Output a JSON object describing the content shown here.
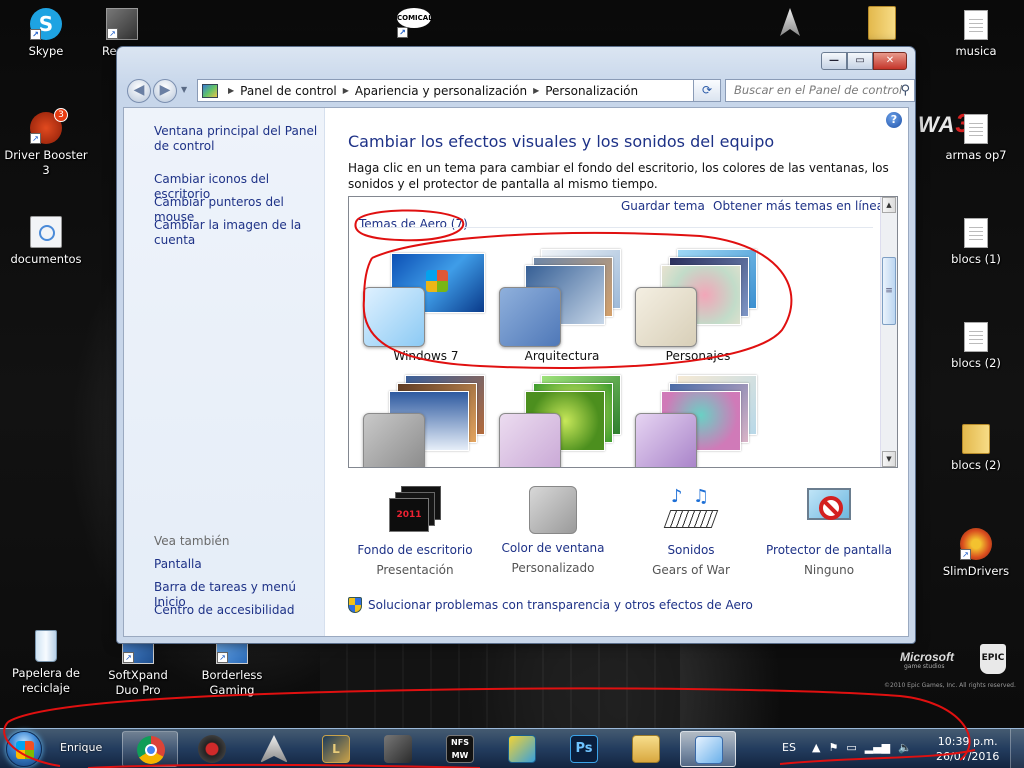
{
  "desktop": {
    "icons_left": [
      {
        "label": "Skype"
      },
      {
        "label": "Driver Booster 3",
        "badge": "3"
      },
      {
        "label": "documentos"
      },
      {
        "label": "Papelera de reciclaje"
      }
    ],
    "icons_bottom": [
      {
        "label": "SoftXpand Duo Pro"
      },
      {
        "label": "Borderless Gaming"
      }
    ],
    "icons_right": [
      {
        "label": "musica"
      },
      {
        "label": "armas op7"
      },
      {
        "label": "blocs (1)"
      },
      {
        "label": "blocs (2)"
      },
      {
        "label": "blocs (2)"
      },
      {
        "label": "SlimDrivers"
      }
    ],
    "partial_label": "Rem",
    "comical_label": "COMICAL",
    "game_logo_left": "WA",
    "game_logo_num": "3",
    "ms_logo": "Microsoft",
    "ms_sub": "game studios",
    "epic_logo": "EPIC",
    "copyright": "©2010 Epic Games, Inc. All rights reserved."
  },
  "window": {
    "breadcrumbs": [
      "Panel de control",
      "Apariencia y personalización",
      "Personalización"
    ],
    "search_placeholder": "Buscar en el Panel de control",
    "sidebar": {
      "links": [
        "Ventana principal del Panel de control",
        "Cambiar iconos del escritorio",
        "Cambiar punteros del mouse",
        "Cambiar la imagen de la cuenta"
      ],
      "see_also_heading": "Vea también",
      "see_also": [
        "Pantalla",
        "Barra de tareas y menú Inicio",
        "Centro de accesibilidad"
      ]
    },
    "title": "Cambiar los efectos visuales y los sonidos del equipo",
    "description": "Haga clic en un tema para cambiar el fondo del escritorio, los colores de las ventanas, los sonidos y el protector de pantalla al mismo tiempo.",
    "save_theme": "Guardar tema",
    "more_themes": "Obtener más temas en línea",
    "group_label": "Temas de Aero (7)",
    "themes": [
      {
        "name": "Windows 7"
      },
      {
        "name": "Arquitectura"
      },
      {
        "name": "Personajes"
      }
    ],
    "bottom": [
      {
        "link": "Fondo de escritorio",
        "value": "Presentación"
      },
      {
        "link": "Color de ventana",
        "value": "Personalizado"
      },
      {
        "link": "Sonidos",
        "value": "Gears of War"
      },
      {
        "link": "Protector de pantalla",
        "value": "Ninguno"
      }
    ],
    "troubleshoot": "Solucionar problemas con transparencia y otros efectos de Aero",
    "wallpaper_year": "2011"
  },
  "taskbar": {
    "user": "Enrique",
    "lang": "ES",
    "time": "10:39 p.m.",
    "date": "26/07/2016"
  },
  "colors": {
    "link": "#1e3287",
    "annotation": "#e01010"
  },
  "icons": {
    "start": "windows-orb-icon",
    "help": "help-icon",
    "search": "search-icon",
    "shield": "uac-shield-icon"
  }
}
